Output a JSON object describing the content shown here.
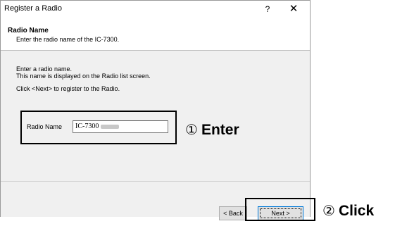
{
  "window": {
    "title": "Register a Radio",
    "help_label": "?",
    "close_label": "✕"
  },
  "header": {
    "title": "Radio Name",
    "subtitle": "Enter the radio name of the IC-7300."
  },
  "body": {
    "instructions": [
      "Enter a radio name.",
      "This name is displayed on the Radio list screen.",
      "Click <Next> to register to the Radio."
    ],
    "field_label": "Radio Name",
    "field_value": "IC-7300"
  },
  "footer": {
    "back_label": "< Back",
    "next_label": "Next >"
  },
  "annotations": {
    "enter_marker": "①",
    "enter_text": "Enter",
    "click_marker": "②",
    "click_text": "Click"
  }
}
